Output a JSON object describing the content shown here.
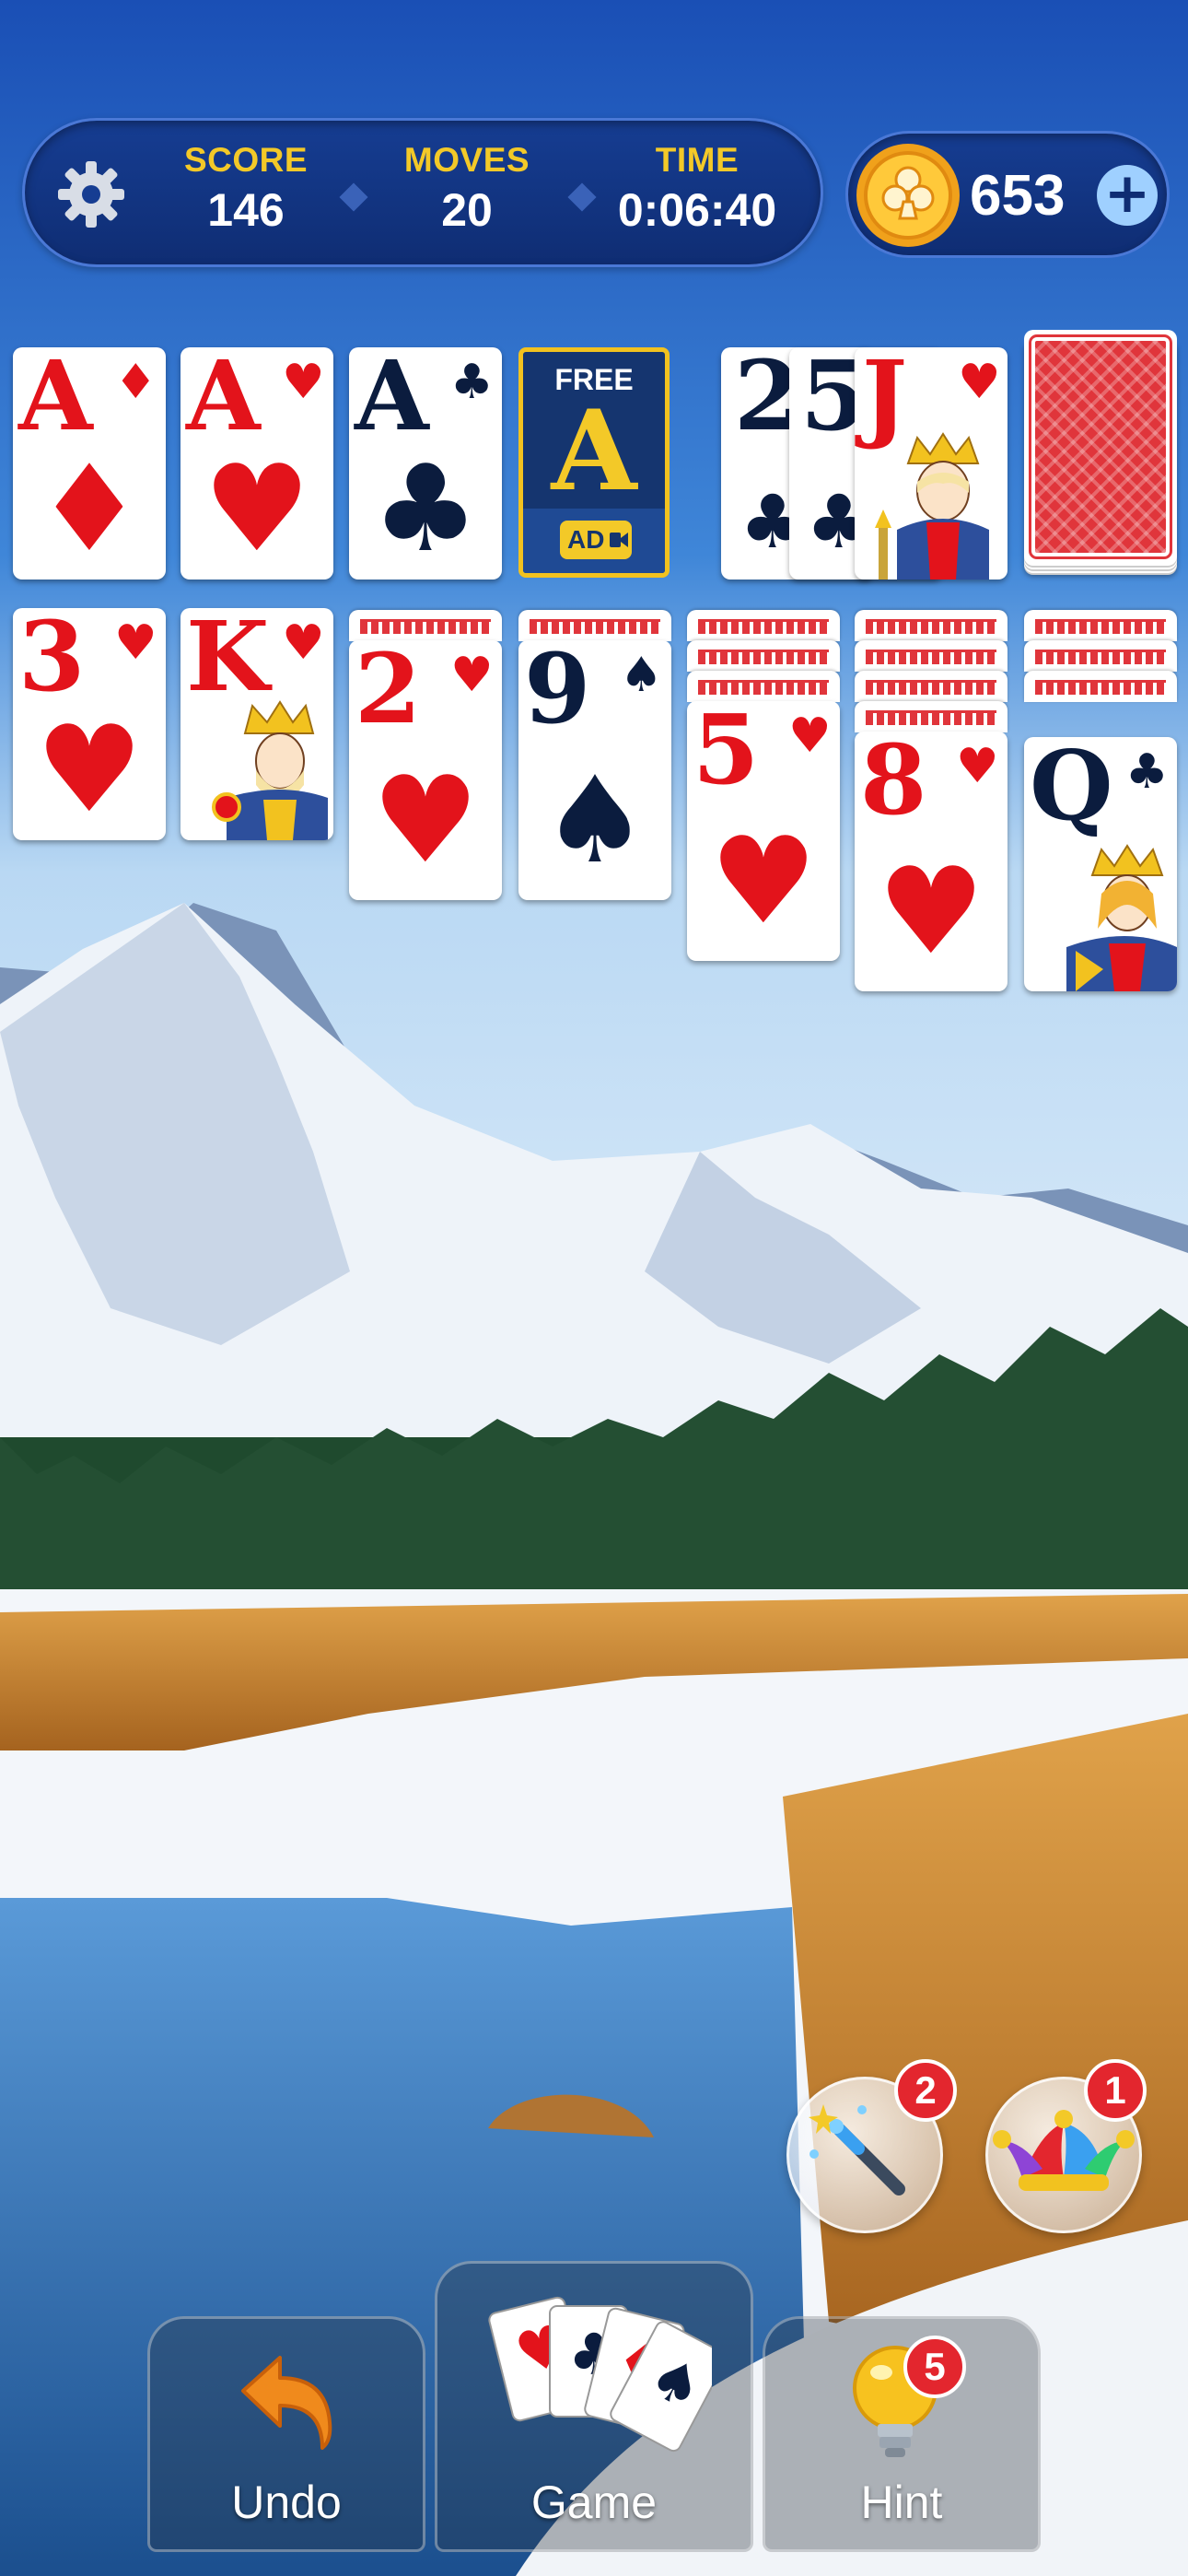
{
  "hud": {
    "score_label": "SCORE",
    "score_value": "146",
    "moves_label": "MOVES",
    "moves_value": "20",
    "time_label": "TIME",
    "time_value": "0:06:40",
    "settings_icon": "gear-icon"
  },
  "coins": {
    "value": "653",
    "add_label": "+",
    "coin_icon": "club-coin-icon"
  },
  "foundations": [
    {
      "rank": "A",
      "suit": "♦",
      "color": "red"
    },
    {
      "rank": "A",
      "suit": "♥",
      "color": "red"
    },
    {
      "rank": "A",
      "suit": "♣",
      "color": "black"
    }
  ],
  "free_slot": {
    "label": "FREE",
    "rank": "A",
    "ad_label": "AD"
  },
  "waste": [
    {
      "rank": "2",
      "suit": "♣"
    },
    {
      "rank": "5",
      "suit": "♣"
    },
    {
      "rank": "J",
      "suit": "♥"
    }
  ],
  "tableau": [
    {
      "rank": "3",
      "suit": "♥"
    },
    {
      "rank": "K",
      "suit": "♥"
    },
    {
      "rank": "2",
      "suit": "♥"
    },
    {
      "rank": "9",
      "suit": "♠"
    },
    {
      "rank": "5",
      "suit": "♥"
    },
    {
      "rank": "8",
      "suit": "♥"
    },
    {
      "rank": "Q",
      "suit": "♣"
    }
  ],
  "powerups": {
    "magic_wand_count": "2",
    "joker_count": "1"
  },
  "bottom_bar": {
    "undo_label": "Undo",
    "game_label": "Game",
    "hint_label": "Hint",
    "hint_count": "5"
  },
  "colors": {
    "card_red": "#e3131b",
    "card_black": "#0b1c3e",
    "hud_gold": "#f3c928",
    "hud_bg": "#163d92",
    "badge_red": "#e3262e"
  }
}
